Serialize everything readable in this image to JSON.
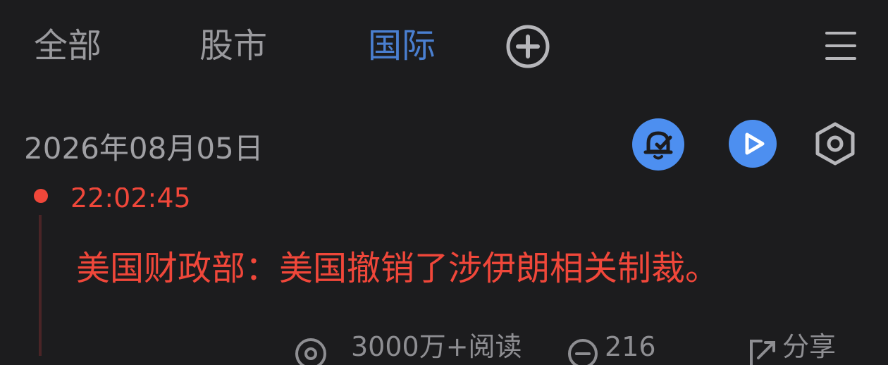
{
  "tabs": [
    {
      "label": "全部",
      "active": false
    },
    {
      "label": "股市",
      "active": false
    },
    {
      "label": "国际",
      "active": true
    }
  ],
  "header": {
    "add_icon": "plus-circle-icon",
    "menu_icon": "hamburger-menu-icon"
  },
  "date": "2026年08月05日",
  "toolbar": {
    "bell_icon": "bell-check-icon",
    "play_icon": "play-icon",
    "settings_icon": "hexagon-settings-icon"
  },
  "news": {
    "time": "22:02:45",
    "headline": "美国财政部：美国撤销了涉伊朗相关制裁。",
    "reads": "3000万+阅读",
    "comments": "216",
    "share": "分享"
  },
  "colors": {
    "background": "#1c1c1e",
    "accent_blue": "#4a7fd0",
    "news_red": "#f0473a",
    "muted_text": "#9a9a9e",
    "button_blue": "#4d8ff0"
  }
}
